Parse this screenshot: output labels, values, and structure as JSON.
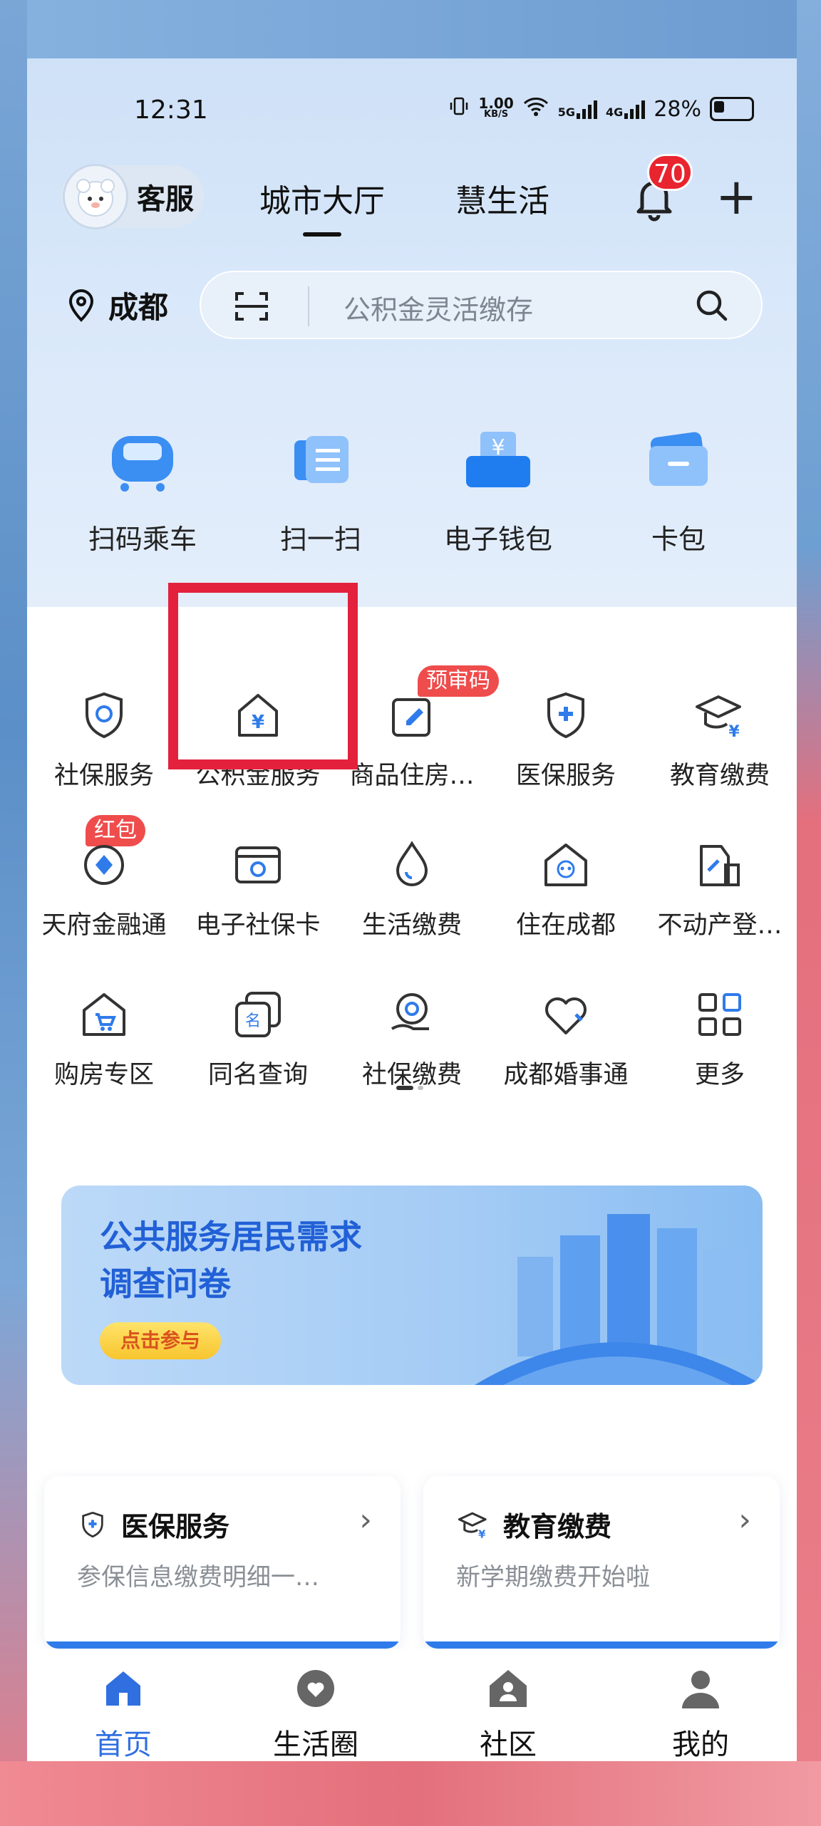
{
  "status_bar": {
    "time": "12:31",
    "net_speed_top": "1.00",
    "net_speed_unit": "KB/S",
    "sig1": "5G",
    "sig2": "4G",
    "battery": "28%"
  },
  "header": {
    "service_label": "客服",
    "tabs": [
      "城市大厅",
      "慧生活"
    ],
    "notification_count": "70"
  },
  "location": {
    "city": "成都"
  },
  "search": {
    "placeholder": "公积金灵活缴存"
  },
  "quick_actions": [
    "扫码乘车",
    "扫一扫",
    "电子钱包",
    "卡包"
  ],
  "services": [
    {
      "label": "社保服务",
      "icon": "shield-social-icon"
    },
    {
      "label": "公积金服务",
      "icon": "house-yuan-icon"
    },
    {
      "label": "商品住房…",
      "icon": "edit-doc-icon",
      "tag": "预审码"
    },
    {
      "label": "医保服务",
      "icon": "shield-plus-icon"
    },
    {
      "label": "教育缴费",
      "icon": "graduation-cap-icon"
    },
    {
      "label": "天府金融通",
      "icon": "diamond-circle-icon",
      "tag": "红包"
    },
    {
      "label": "电子社保卡",
      "icon": "id-card-icon"
    },
    {
      "label": "生活缴费",
      "icon": "water-drop-icon"
    },
    {
      "label": "住在成都",
      "icon": "panda-house-icon"
    },
    {
      "label": "不动产登…",
      "icon": "building-doc-icon"
    },
    {
      "label": "购房专区",
      "icon": "house-cart-icon"
    },
    {
      "label": "同名查询",
      "icon": "name-search-icon"
    },
    {
      "label": "社保缴费",
      "icon": "social-pay-icon"
    },
    {
      "label": "成都婚事通",
      "icon": "heart-icon"
    },
    {
      "label": "更多",
      "icon": "grid-more-icon"
    }
  ],
  "banner": {
    "line1": "公共服务居民需求",
    "line2": "调查问卷",
    "button": "点击参与"
  },
  "cards": [
    {
      "title": "医保服务",
      "subtitle": "参保信息缴费明细一…"
    },
    {
      "title": "教育缴费",
      "subtitle": "新学期缴费开始啦"
    }
  ],
  "tabbar": [
    "首页",
    "生活圈",
    "社区",
    "我的"
  ],
  "colors": {
    "accent": "#2f6fe0",
    "highlight_box": "#e3213d",
    "badge": "#e8242f"
  }
}
